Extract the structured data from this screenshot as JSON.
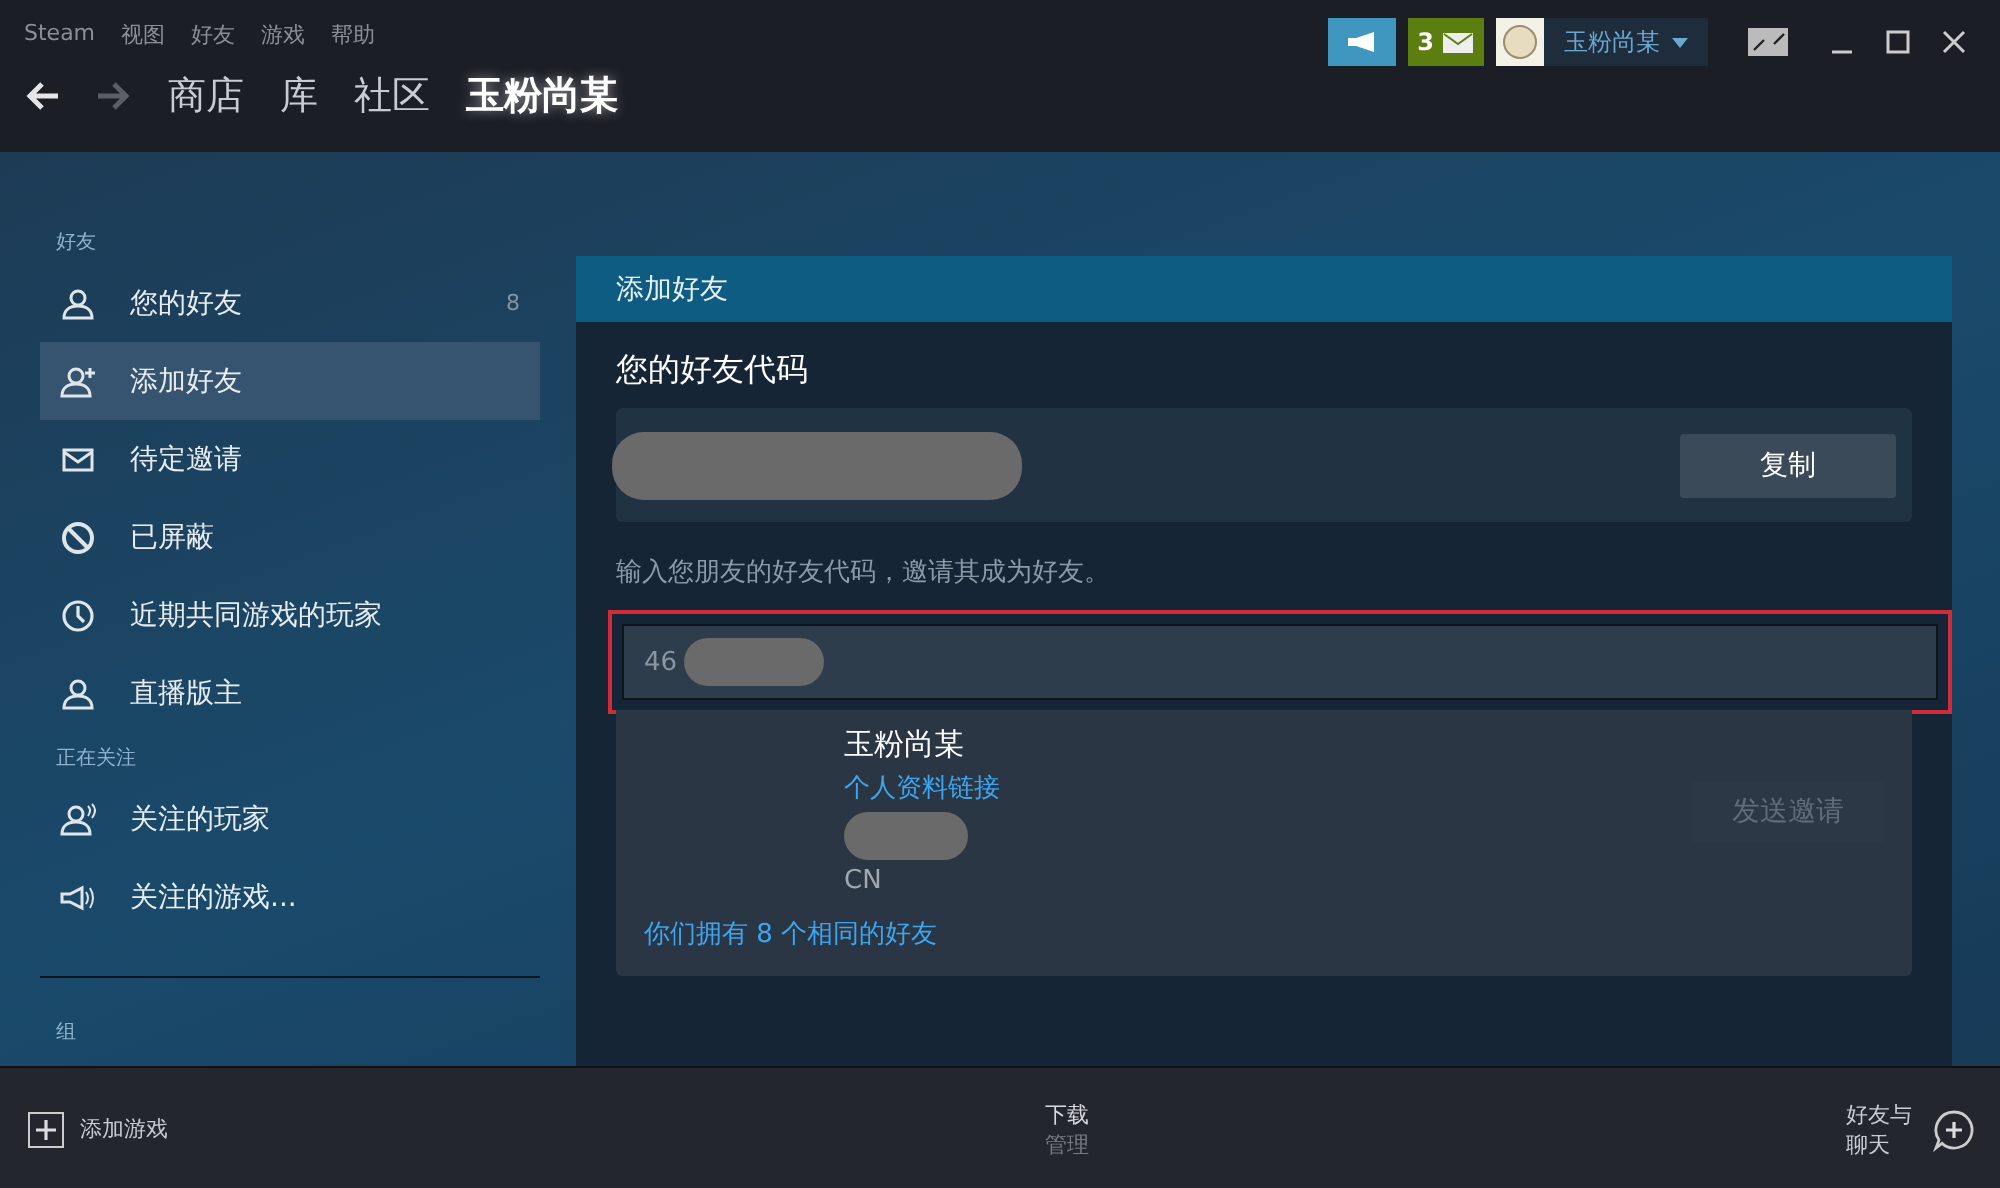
{
  "menu": [
    "Steam",
    "视图",
    "好友",
    "游戏",
    "帮助"
  ],
  "nav": [
    {
      "label": "商店",
      "selected": false
    },
    {
      "label": "库",
      "selected": false
    },
    {
      "label": "社区",
      "selected": false
    },
    {
      "label": "玉粉尚某",
      "selected": true
    }
  ],
  "top_right": {
    "notifications": "3",
    "user": "玉粉尚某"
  },
  "sidebar": {
    "sections": [
      {
        "title": "好友",
        "items": [
          {
            "label": "您的好友",
            "count": "8",
            "selected": false
          },
          {
            "label": "添加好友",
            "selected": true
          },
          {
            "label": "待定邀请",
            "selected": false
          },
          {
            "label": "已屏蔽",
            "selected": false
          },
          {
            "label": "近期共同游戏的玩家",
            "selected": false
          },
          {
            "label": "直播版主",
            "selected": false
          }
        ]
      },
      {
        "title": "正在关注",
        "items": [
          {
            "label": "关注的玩家",
            "selected": false
          },
          {
            "label": "关注的游戏...",
            "selected": false
          }
        ]
      },
      {
        "title": "组"
      }
    ]
  },
  "panel": {
    "title": "添加好友",
    "code_heading": "您的好友代码",
    "copy_button": "复制",
    "hint": "输入您朋友的好友代码，邀请其成为好友。",
    "input_value": "46",
    "result": {
      "name": "玉粉尚某",
      "profile_link": "个人资料链接",
      "country": "CN",
      "send_button": {
        "label": "发送邀请",
        "disabled": true
      },
      "mutual": "你们拥有 8 个相同的好友"
    }
  },
  "bottom_bar": {
    "add_game": "添加游戏",
    "downloads": "下载",
    "downloads_sub": "管理",
    "friends_chat": [
      "好友与",
      "聊天"
    ]
  }
}
